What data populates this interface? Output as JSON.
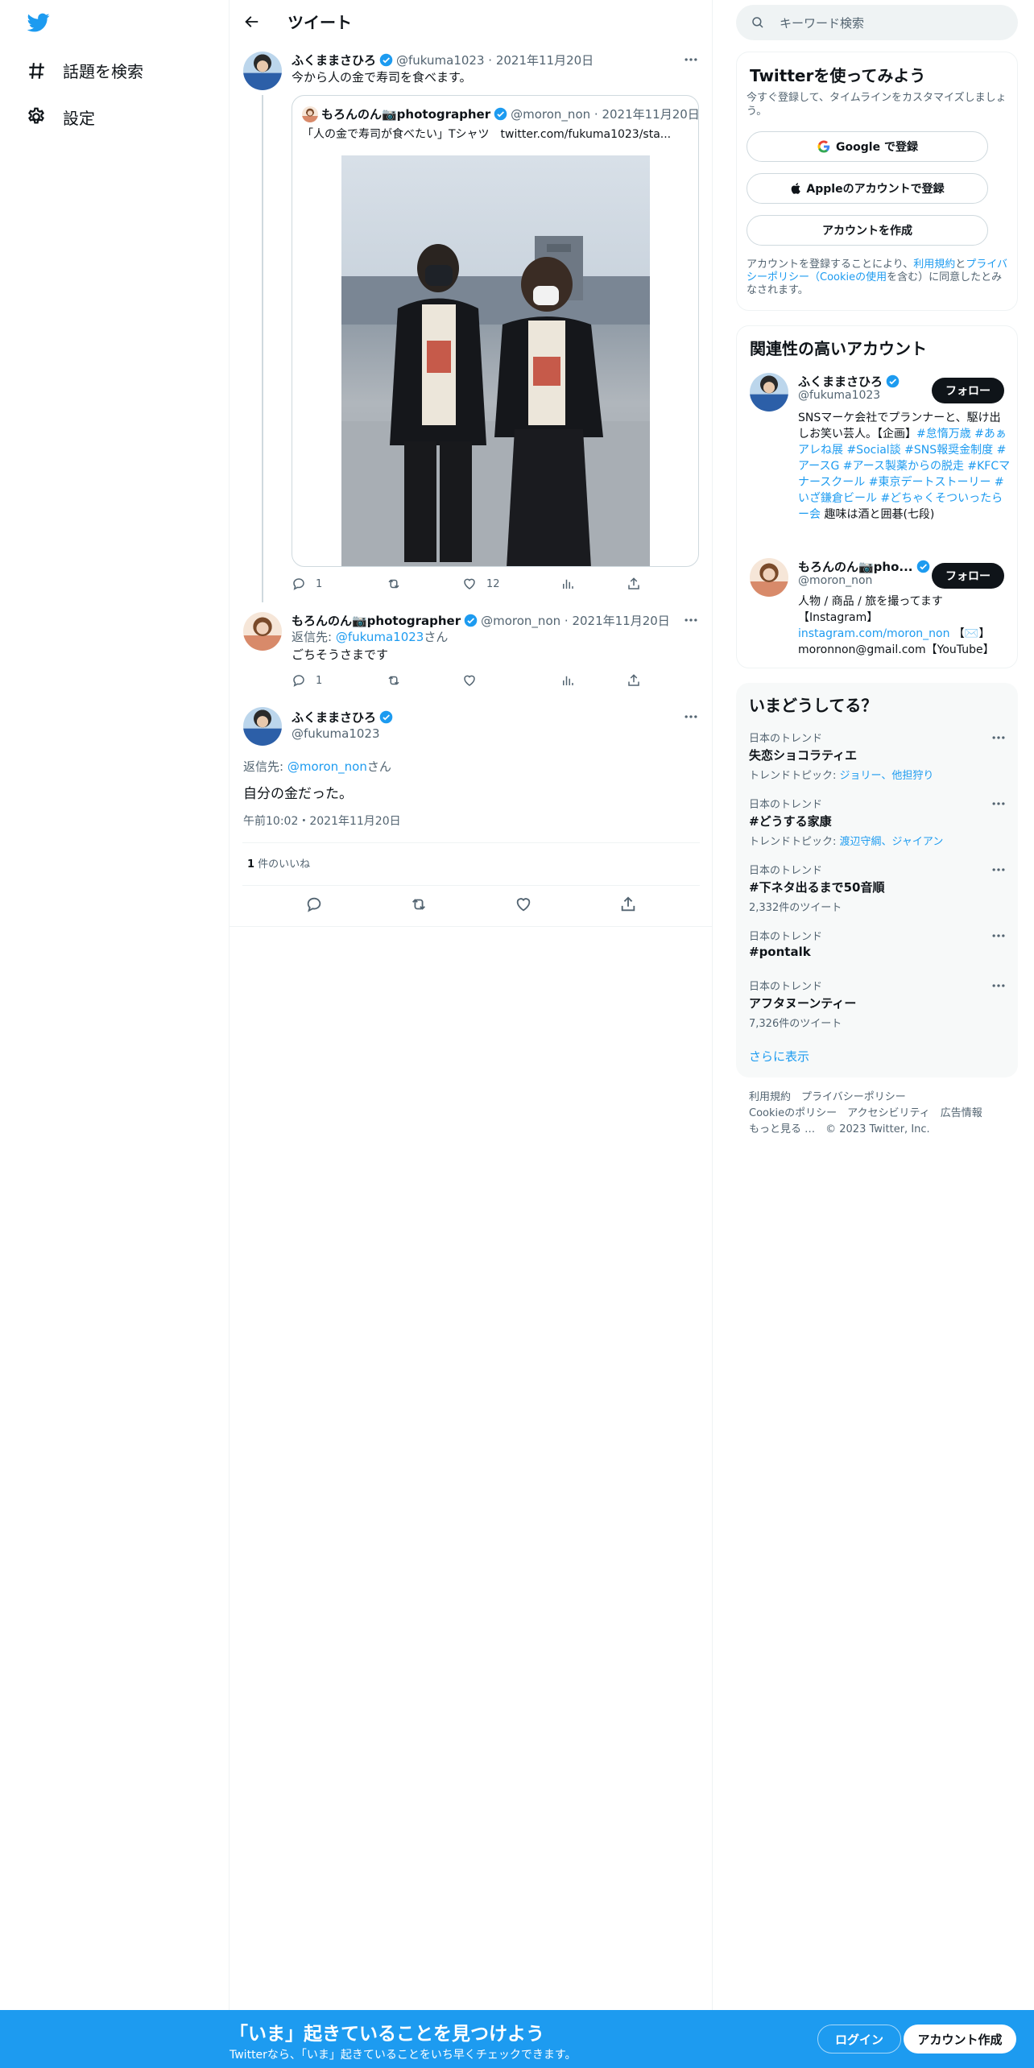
{
  "nav": {
    "explore": "話題を検索",
    "settings": "設定"
  },
  "header": {
    "title": "ツイート"
  },
  "tweet1": {
    "name": "ふくままさひろ",
    "handle": "@fukuma1023",
    "date": "2021年11月20日",
    "text": "今から人の金で寿司を食べます。",
    "quote": {
      "name": "もろんのん📷photographer",
      "handle": "@moron_non",
      "date": "2021年11月20日",
      "text": "「人の金で寿司が食べたい」Tシャツ　twitter.com/fukuma1023/sta..."
    },
    "replies": "1",
    "likes": "12"
  },
  "tweet2": {
    "name": "もろんのん📷photographer",
    "handle": "@moron_non",
    "date": "2021年11月20日",
    "reply_prefix": "返信先: ",
    "reply_to": "@fukuma1023",
    "reply_suffix": "さん",
    "text": "ごちそうさまです",
    "replies": "1"
  },
  "main_tweet": {
    "name": "ふくままさひろ",
    "handle": "@fukuma1023",
    "reply_prefix": "返信先: ",
    "reply_to": "@moron_non",
    "reply_suffix": "さん",
    "text": "自分の金だった。",
    "timestamp": "午前10:02・2021年11月20日",
    "likes_count": "1",
    "likes_label": " 件のいいね"
  },
  "search": {
    "placeholder": "キーワード検索"
  },
  "signup_card": {
    "title": "Twitterを使ってみよう",
    "subtitle": "今すぐ登録して、タイムラインをカスタマイズしましょう。",
    "google": "Google で登録",
    "apple": "Appleのアカウントで登録",
    "create": "アカウントを作成",
    "terms_1": "アカウントを登録することにより、",
    "terms_link1": "利用規約",
    "terms_2": "と",
    "terms_link2": "プライバシーポリシー（Cookieの使用",
    "terms_3": "を含む）に同意したとみなされます。"
  },
  "related": {
    "title": "関連性の高いアカウント",
    "follow": "フォロー",
    "accounts": [
      {
        "name": "ふくままさひろ",
        "handle": "@fukuma1023",
        "bio_plain1": "SNSマーケ会社でプランナーと、駆け出しお笑い芸人。【企画】",
        "bio_links": "#怠惰万歳 #あぁアレね展 #Social談 #SNS報奨金制度 #アースG #アース製薬からの脱走 #KFCマナースクール #東京デートストーリー #いざ鎌倉ビール #どちゃくそついったらー会",
        "bio_plain2": " 趣味は酒と囲碁(七段)"
      },
      {
        "name": "もろんのん📷pho...",
        "handle": "@moron_non",
        "bio_plain1": "人物 / 商品 / 旅を撮ってます【Instagram】",
        "bio_links": "instagram.com/moron_non",
        "bio_plain2": " 【✉️】moronnon@gmail.com【YouTube】"
      }
    ]
  },
  "trends": {
    "title": "いまどうしてる？",
    "items": [
      {
        "context": "日本のトレンド",
        "title": "失恋ショコラティエ",
        "sub_prefix": "トレンドトピック: ",
        "sub_links": "ジョリー、他担狩り",
        "count": ""
      },
      {
        "context": "日本のトレンド",
        "title": "#どうする家康",
        "sub_prefix": "トレンドトピック: ",
        "sub_links": "渡辺守綱、ジャイアン",
        "count": ""
      },
      {
        "context": "日本のトレンド",
        "title": "#下ネタ出るまで50音順",
        "sub_prefix": "",
        "sub_links": "",
        "count": "2,332件のツイート"
      },
      {
        "context": "日本のトレンド",
        "title": "#pontalk",
        "sub_prefix": "",
        "sub_links": "",
        "count": ""
      },
      {
        "context": "日本のトレンド",
        "title": "アフタヌーンティー",
        "sub_prefix": "",
        "sub_links": "",
        "count": "7,326件のツイート"
      }
    ],
    "show_more": "さらに表示"
  },
  "footer": {
    "line1": "利用規約　プライバシーポリシー",
    "line2": "Cookieのポリシー　アクセシビリティ　広告情報",
    "line3": "もっと見る …　© 2023 Twitter, Inc."
  },
  "banner": {
    "headline": "「いま」起きていることを見つけよう",
    "sub": "Twitterなら、「いま」起きていることをいち早くチェックできます。",
    "login": "ログイン",
    "signup": "アカウント作成"
  },
  "colors": {
    "accent": "#1d9bf0",
    "text": "#0f1419",
    "muted": "#536471"
  }
}
